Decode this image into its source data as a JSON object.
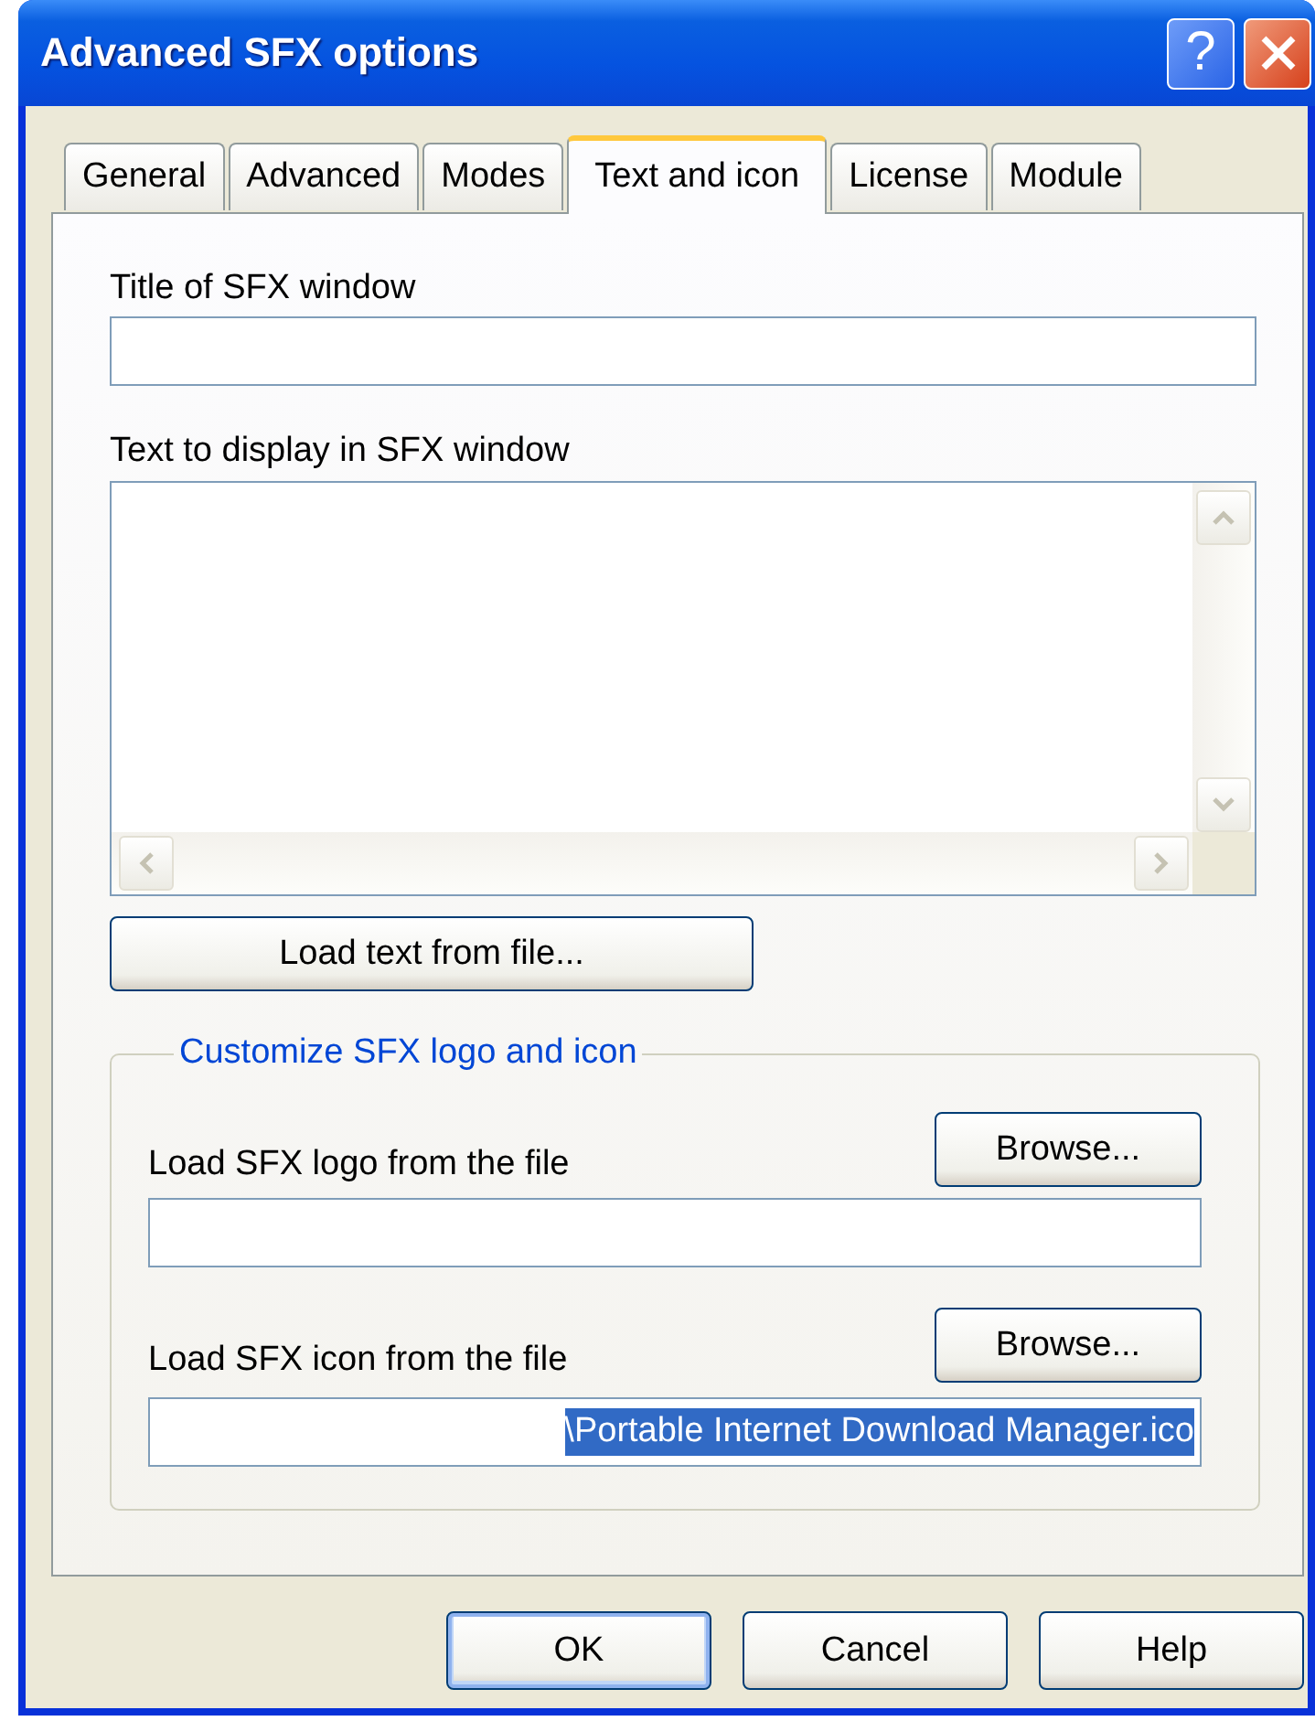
{
  "window": {
    "title": "Advanced SFX options",
    "help_button": "?"
  },
  "tabs": [
    {
      "label": "General",
      "selected": false
    },
    {
      "label": "Advanced",
      "selected": false
    },
    {
      "label": "Modes",
      "selected": false
    },
    {
      "label": "Text and icon",
      "selected": true
    },
    {
      "label": "License",
      "selected": false
    },
    {
      "label": "Module",
      "selected": false
    }
  ],
  "title_field": {
    "label": "Title of SFX window"
  },
  "text_field": {
    "label": "Text to display in SFX window"
  },
  "load_text_button": "Load text from file...",
  "logo_group": {
    "legend": "Customize SFX logo and icon",
    "rows": [
      {
        "label": "Load SFX logo from the file",
        "button": "Browse..."
      },
      {
        "label": "Load SFX icon from the file",
        "button": "Browse...",
        "value": "\\Portable Internet Download Manager.ico",
        "text_selected": true
      }
    ]
  },
  "buttons": [
    {
      "label": "OK",
      "default": true
    },
    {
      "label": "Cancel",
      "default": false
    },
    {
      "label": "Help",
      "default": false
    }
  ]
}
